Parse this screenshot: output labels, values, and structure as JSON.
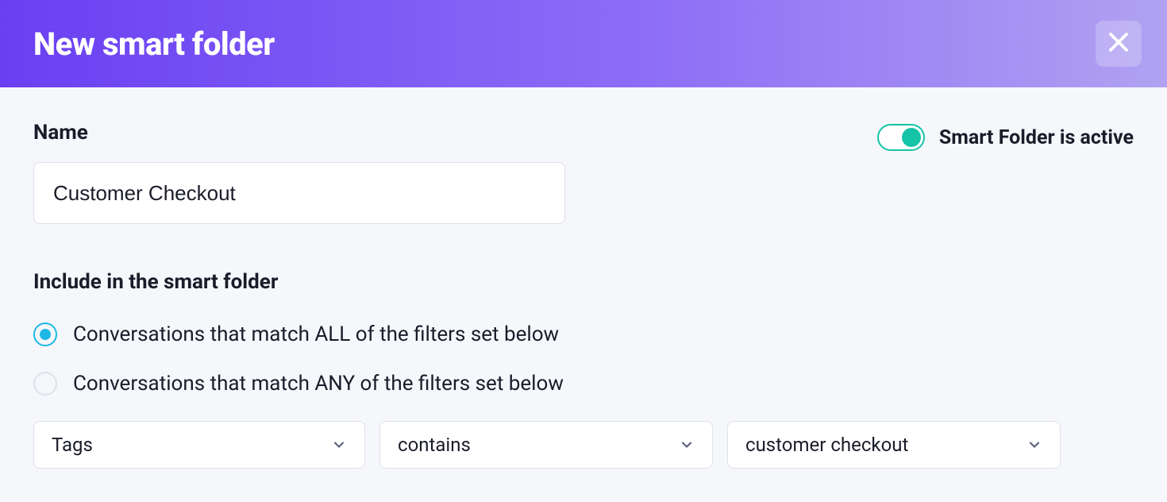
{
  "header": {
    "title": "New smart folder"
  },
  "form": {
    "name_label": "Name",
    "name_value": "Customer Checkout",
    "active_label": "Smart Folder is active",
    "active_on": true,
    "include_heading": "Include in the smart folder",
    "radio_all": "Conversations that match ALL of the filters set below",
    "radio_any": "Conversations that match ANY of the filters set below",
    "radio_selected": "all"
  },
  "filter": {
    "field": "Tags",
    "operator": "contains",
    "value": "customer checkout"
  }
}
